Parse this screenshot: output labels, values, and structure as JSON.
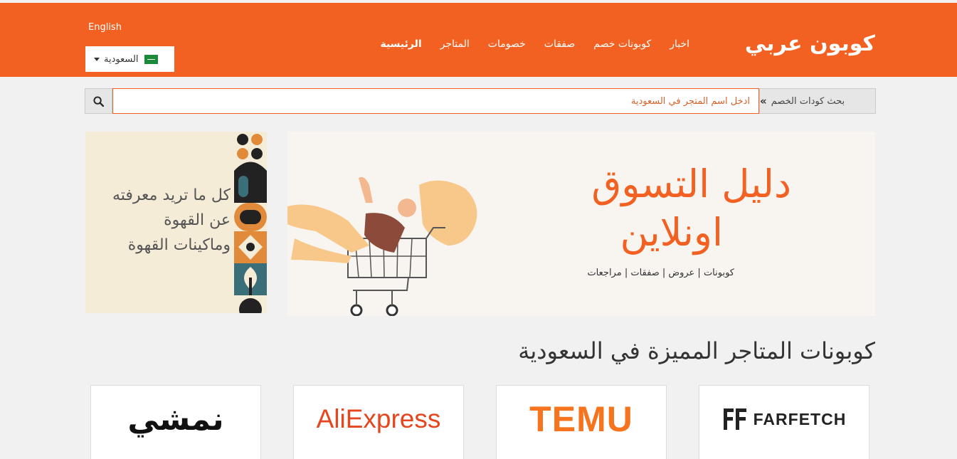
{
  "header": {
    "logo_text": "كوبون عربي",
    "nav": [
      "الرئيسية",
      "المتاجر",
      "خصومات",
      "صفقات",
      "كوبونات خصم",
      "اخبار"
    ],
    "lang_label": "English",
    "country_label": "السعودية",
    "brand_color": "#f26122"
  },
  "search": {
    "label": "بحث كودات الخصم",
    "placeholder": "ادخل اسم المتجر في السعودية"
  },
  "side_banner": {
    "lines": [
      "كل ما تريد معرفته",
      "عن القهوة",
      "وماكينات القهوة"
    ]
  },
  "main_banner": {
    "title_line1": "دليل التسوق",
    "title_line2": "اونلاين",
    "subtitle": "كوبونات | عروض | صفقات | مراجعات"
  },
  "section": {
    "title": "كوبونات المتاجر المميزة في السعودية"
  },
  "stores": [
    {
      "name": "نمشي"
    },
    {
      "name": "AliExpress"
    },
    {
      "name": "TEMU"
    },
    {
      "name": "FARFETCH"
    }
  ]
}
